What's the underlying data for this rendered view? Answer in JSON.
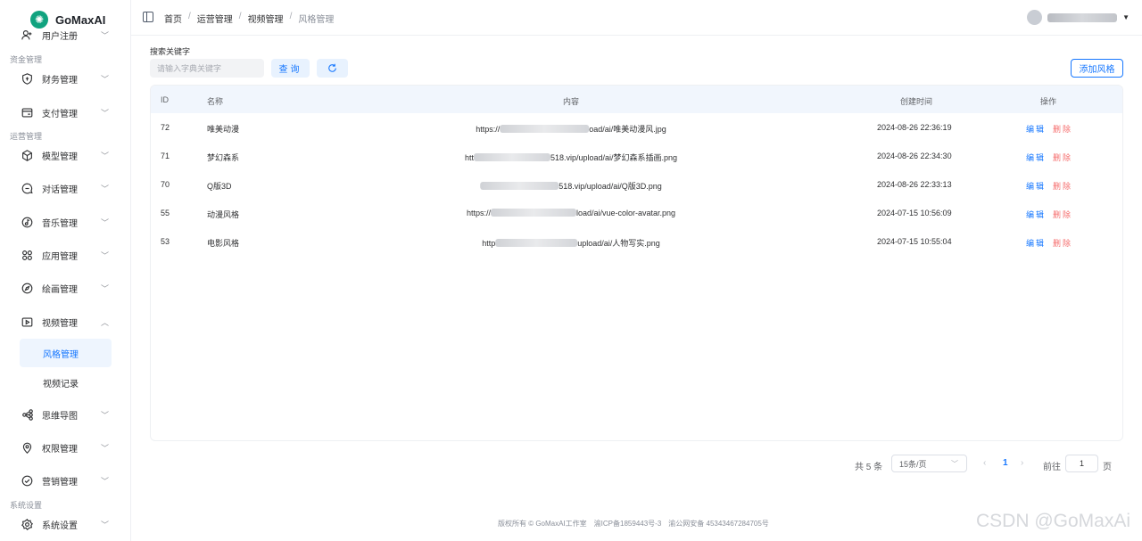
{
  "app": {
    "name": "GoMaxAI"
  },
  "sidebar": {
    "items": [
      {
        "label": "用户注册",
        "icon": "user-add-icon"
      },
      {
        "label": "资金管理",
        "type": "group"
      },
      {
        "label": "财务管理",
        "icon": "shield-dollar-icon"
      },
      {
        "label": "支付管理",
        "icon": "wallet-icon"
      },
      {
        "label": "运营管理",
        "type": "group"
      },
      {
        "label": "模型管理",
        "icon": "cube-icon"
      },
      {
        "label": "对话管理",
        "icon": "chat-icon"
      },
      {
        "label": "音乐管理",
        "icon": "music-icon"
      },
      {
        "label": "应用管理",
        "icon": "apps-icon"
      },
      {
        "label": "绘画管理",
        "icon": "compass-icon"
      },
      {
        "label": "视频管理",
        "icon": "video-icon",
        "expanded": true
      },
      {
        "label": "风格管理",
        "type": "sub",
        "active": true
      },
      {
        "label": "视频记录",
        "type": "sub"
      },
      {
        "label": "思维导图",
        "icon": "mindmap-icon"
      },
      {
        "label": "权限管理",
        "icon": "location-shield-icon"
      },
      {
        "label": "营销管理",
        "icon": "check-circle-icon"
      },
      {
        "label": "系统设置",
        "type": "group"
      },
      {
        "label": "系统设置",
        "icon": "settings-icon"
      }
    ]
  },
  "header": {
    "breadcrumbs": [
      "首页",
      "运营管理",
      "视频管理",
      "风格管理"
    ],
    "separator": "/"
  },
  "search": {
    "label": "搜索关键字",
    "placeholder": "请输入字典关键字",
    "query_label": "查询",
    "add_label": "添加风格"
  },
  "table": {
    "headers": [
      "ID",
      "名称",
      "内容",
      "创建时间",
      "操作"
    ],
    "edit_label": "编辑",
    "delete_label": "删除",
    "rows": [
      {
        "id": "72",
        "name": "唯美动漫",
        "content_prefix": "https://",
        "content_suffix": "oad/ai/唯美动漫风.jpg",
        "created": "2024-08-26 22:36:19"
      },
      {
        "id": "71",
        "name": "梦幻森系",
        "content_prefix": "htt",
        "content_suffix": "518.vip/upload/ai/梦幻森系插画.png",
        "created": "2024-08-26 22:34:30"
      },
      {
        "id": "70",
        "name": "Q版3D",
        "content_prefix": "",
        "content_suffix": "518.vip/upload/ai/Q版3D.png",
        "created": "2024-08-26 22:33:13"
      },
      {
        "id": "55",
        "name": "动漫风格",
        "content_prefix": "https://",
        "content_suffix": "load/ai/vue-color-avatar.png",
        "created": "2024-07-15 10:56:09"
      },
      {
        "id": "53",
        "name": "电影风格",
        "content_prefix": "http",
        "content_suffix": "upload/ai/人物写实.png",
        "created": "2024-07-15 10:55:04"
      }
    ]
  },
  "pagination": {
    "total": "共 5 条",
    "page_size": "15条/页",
    "current": "1",
    "goto_label": "前往",
    "goto_value": "1",
    "page_label": "页"
  },
  "footer": {
    "copyright": "版权所有 © GoMaxAI工作室",
    "icp": "渝ICP备1859443号-3",
    "police": "渝公网安备 45343467284705号"
  },
  "watermark": "CSDN @GoMaxAi",
  "colors": {
    "primary": "#1677ff",
    "danger": "#f56c6c",
    "brand": "#10a37f"
  }
}
